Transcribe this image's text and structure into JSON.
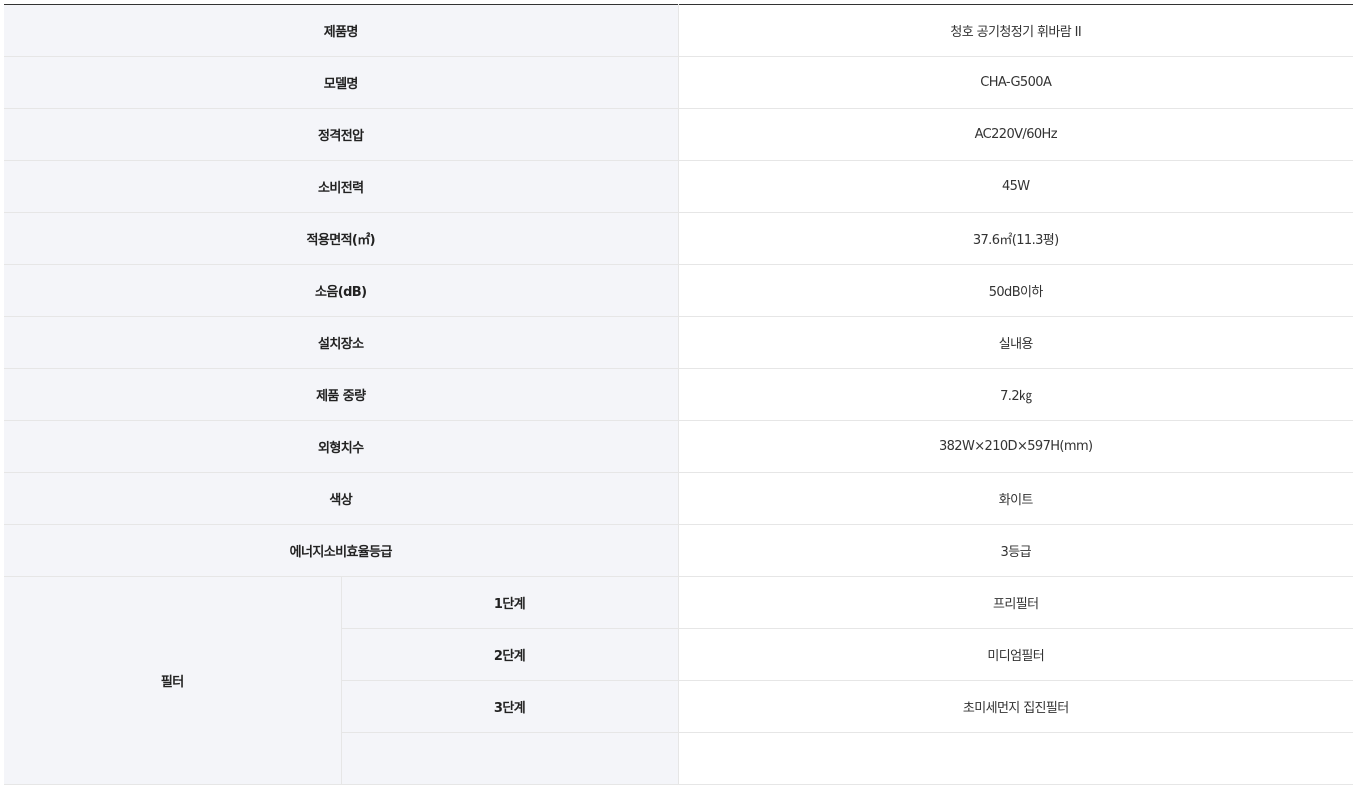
{
  "specs": [
    {
      "label": "제품명",
      "value": "청호 공기청정기 휘바람 II"
    },
    {
      "label": "모델명",
      "value": "CHA-G500A"
    },
    {
      "label": "정격전압",
      "value": "AC220V/60Hz"
    },
    {
      "label": "소비전력",
      "value": "45W"
    },
    {
      "label": "적용면적(㎡)",
      "value": "37.6㎡(11.3평)"
    },
    {
      "label": "소음(dB)",
      "value": "50dB이하"
    },
    {
      "label": "설치장소",
      "value": "실내용"
    },
    {
      "label": "제품 중량",
      "value": "7.2㎏"
    },
    {
      "label": "외형치수",
      "value": "382W×210D×597H(mm)"
    },
    {
      "label": "색상",
      "value": "화이트"
    },
    {
      "label": "에너지소비효율등급",
      "value": "3등급"
    }
  ],
  "filter": {
    "label": "필터",
    "stages": [
      {
        "label": "1단계",
        "value": "프리필터"
      },
      {
        "label": "2단계",
        "value": "미디엄필터"
      },
      {
        "label": "3단계",
        "value": "초미세먼지 집진필터"
      }
    ]
  }
}
